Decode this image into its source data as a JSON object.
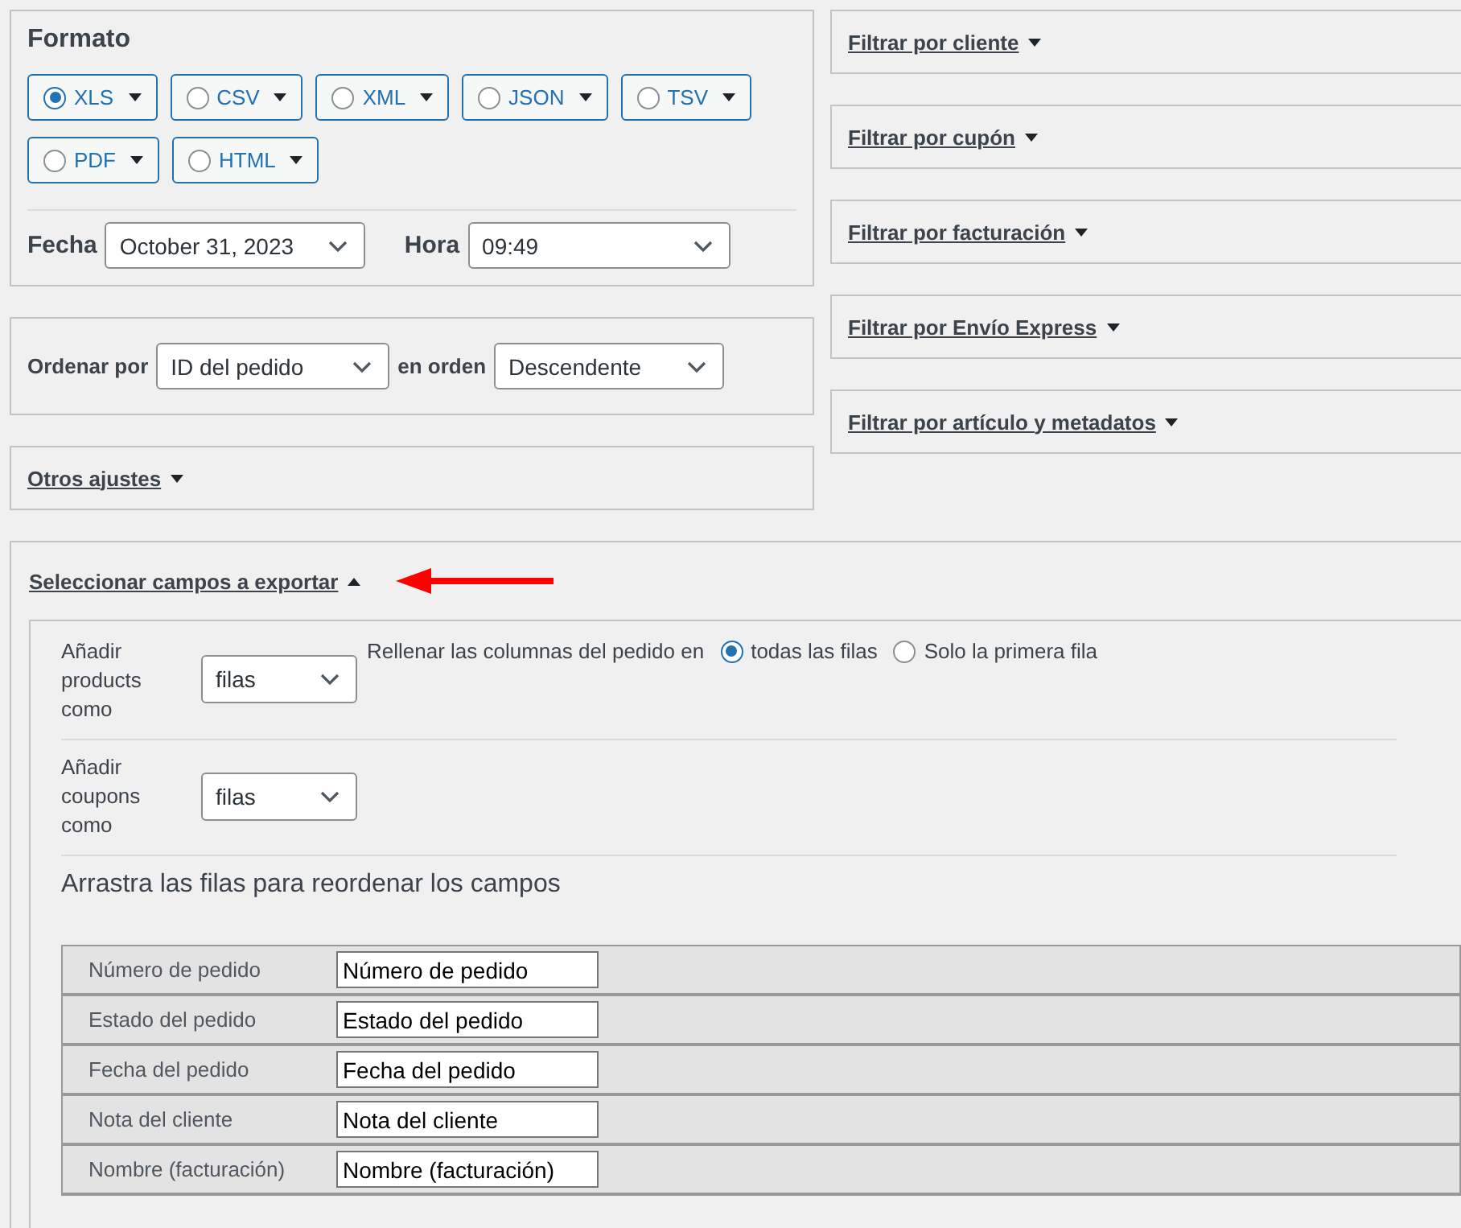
{
  "format": {
    "title": "Formato",
    "options": [
      {
        "label": "XLS",
        "selected": true
      },
      {
        "label": "CSV",
        "selected": false
      },
      {
        "label": "XML",
        "selected": false
      },
      {
        "label": "JSON",
        "selected": false
      },
      {
        "label": "TSV",
        "selected": false
      },
      {
        "label": "PDF",
        "selected": false
      },
      {
        "label": "HTML",
        "selected": false
      }
    ],
    "date": {
      "label": "Fecha",
      "value": "October 31, 2023"
    },
    "time": {
      "label": "Hora",
      "value": "09:49"
    }
  },
  "sort": {
    "label": "Ordenar por",
    "field": "ID del pedido",
    "order_label": "en orden",
    "order": "Descendente"
  },
  "other_settings": {
    "label": "Otros ajustes",
    "expanded": false
  },
  "filters": [
    {
      "label": "Filtrar por cliente",
      "expanded": false
    },
    {
      "label": "Filtrar por cupón",
      "expanded": false
    },
    {
      "label": "Filtrar por facturación",
      "expanded": false
    },
    {
      "label": "Filtrar por Envío Express",
      "expanded": false
    },
    {
      "label": "Filtrar por artículo y metadatos",
      "expanded": false
    }
  ],
  "fields_section": {
    "label": "Seleccionar campos a exportar",
    "expanded": true,
    "products": {
      "label": "Añadir products como",
      "value": "filas"
    },
    "fill": {
      "label": "Rellenar las columnas del pedido en",
      "options": [
        {
          "label": "todas las filas",
          "selected": true
        },
        {
          "label": "Solo la primera fila",
          "selected": false
        }
      ]
    },
    "coupons": {
      "label": "Añadir coupons como",
      "value": "filas"
    },
    "hint": "Arrastra las filas para reordenar los campos",
    "fields": [
      {
        "name": "Número de pedido",
        "value": "Número de pedido"
      },
      {
        "name": "Estado del pedido",
        "value": "Estado del pedido"
      },
      {
        "name": "Fecha del pedido",
        "value": "Fecha del pedido"
      },
      {
        "name": "Nota del cliente",
        "value": "Nota del cliente"
      },
      {
        "name": "Nombre (facturación)",
        "value": "Nombre (facturación)"
      }
    ]
  }
}
